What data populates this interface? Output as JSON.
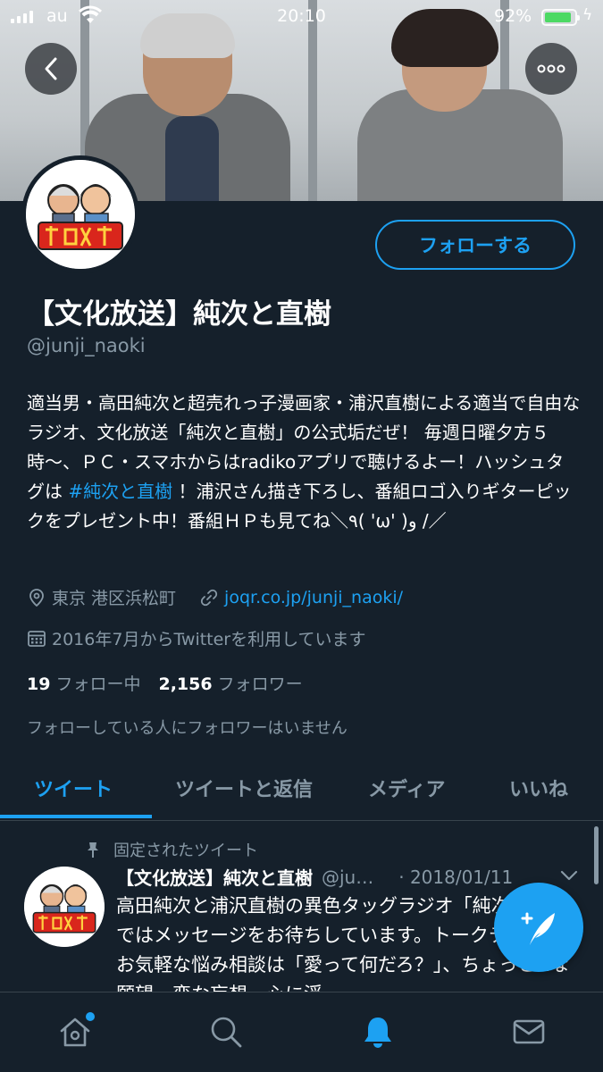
{
  "status_bar": {
    "carrier": "au",
    "time": "20:10",
    "battery_percent": "92%",
    "battery_level": 0.92,
    "battery_color": "#4cd964"
  },
  "header": {
    "back_icon": "chevron-left-icon",
    "more_icon": "more-horizontal-icon"
  },
  "profile": {
    "follow_label": "フォローする",
    "display_name": "【文化放送】純次と直樹",
    "handle": "@junji_naoki",
    "bio_part1": "適当男・高田純次と超売れっ子漫画家・浦沢直樹による適当で自由なラジオ、文化放送「純次と直樹」の公式垢だぜ！ 毎週日曜夕方５時〜、ＰＣ・スマホからはradikoアプリで聴けるよー！ハッシュタグは ",
    "bio_hashtag": "#純次と直樹",
    "bio_part2": " ！浦沢さん描き下ろし、番組ロゴ入りギターピックをプレゼント中！番組ＨＰも見てね＼٩( 'ω' )و /／",
    "location": "東京 港区浜松町",
    "link": "joqr.co.jp/junji_naoki/",
    "joined": "2016年7月からTwitterを利用しています",
    "following_count": "19",
    "following_label": "フォロー中",
    "followers_count": "2,156",
    "followers_label": "フォロワー",
    "no_followers_you_know": "フォローしている人にフォロワーはいません"
  },
  "tabs": [
    {
      "label": "ツイート",
      "active": true
    },
    {
      "label": "ツイートと返信",
      "active": false
    },
    {
      "label": "メディア",
      "active": false
    },
    {
      "label": "いいね",
      "active": false
    }
  ],
  "pinned_tweet": {
    "pinned_label": "固定されたツイート",
    "name": "【文化放送】純次と直樹",
    "handle": "@ju…",
    "date": "· 2018/01/11",
    "text": "高田純次と浦沢直樹の異色タッグラジオ「純次と直樹」ではメッセージをお待ちしています。トークテーマやお気軽な悩み相談は「愛って何だろ？」、ちょっとHな願望、変な妄想、心に浮"
  },
  "bottom_nav": [
    {
      "icon": "home-icon",
      "has_notification_dot": true
    },
    {
      "icon": "search-icon",
      "has_notification_dot": false
    },
    {
      "icon": "bell-icon",
      "active": true
    },
    {
      "icon": "mail-icon",
      "has_notification_dot": false
    }
  ],
  "colors": {
    "background": "#15202b",
    "accent": "#1da1f2",
    "secondary_text": "#8899a6",
    "divider": "#38444d"
  }
}
